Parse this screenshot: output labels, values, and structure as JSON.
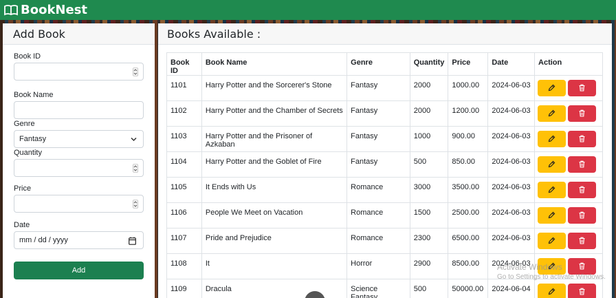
{
  "app": {
    "name": "BookNest"
  },
  "form": {
    "title": "Add Book",
    "fields": {
      "book_id": {
        "label": "Book ID",
        "value": ""
      },
      "book_name": {
        "label": "Book Name",
        "value": ""
      },
      "genre": {
        "label": "Genre",
        "value": "Fantasy"
      },
      "quantity": {
        "label": "Quantity",
        "value": ""
      },
      "price": {
        "label": "Price",
        "value": ""
      },
      "date": {
        "label": "Date",
        "value": "mm / dd / yyyy"
      }
    },
    "submit_label": "Add"
  },
  "books": {
    "title": "Books Available :",
    "columns": [
      "Book ID",
      "Book Name",
      "Genre",
      "Quantity",
      "Price",
      "Date",
      "Action"
    ],
    "rows": [
      {
        "id": "1101",
        "name": "Harry Potter and the Sorcerer's Stone",
        "genre": "Fantasy",
        "quantity": "2000",
        "price": "1000.00",
        "date": "2024-06-03"
      },
      {
        "id": "1102",
        "name": "Harry Potter and the Chamber of Secrets",
        "genre": "Fantasy",
        "quantity": "2000",
        "price": "1200.00",
        "date": "2024-06-03"
      },
      {
        "id": "1103",
        "name": "Harry Potter and the Prisoner of Azkaban",
        "genre": "Fantasy",
        "quantity": "1000",
        "price": "900.00",
        "date": "2024-06-03"
      },
      {
        "id": "1104",
        "name": "Harry Potter and the Goblet of Fire",
        "genre": "Fantasy",
        "quantity": "500",
        "price": "850.00",
        "date": "2024-06-03"
      },
      {
        "id": "1105",
        "name": "It Ends with Us",
        "genre": "Romance",
        "quantity": "3000",
        "price": "3500.00",
        "date": "2024-06-03"
      },
      {
        "id": "1106",
        "name": "People We Meet on Vacation",
        "genre": "Romance",
        "quantity": "1500",
        "price": "2500.00",
        "date": "2024-06-03"
      },
      {
        "id": "1107",
        "name": "Pride and Prejudice",
        "genre": "Romance",
        "quantity": "2300",
        "price": "6500.00",
        "date": "2024-06-03"
      },
      {
        "id": "1108",
        "name": "It",
        "genre": "Horror",
        "quantity": "2900",
        "price": "8500.00",
        "date": "2024-06-03"
      },
      {
        "id": "1109",
        "name": "Dracula",
        "genre": "Science Fantasy",
        "quantity": "500",
        "price": "50000.00",
        "date": "2024-06-04"
      }
    ]
  },
  "watermark": {
    "title": "Activate Windows",
    "subtitle": "Go to Settings to activate Windows."
  },
  "colors": {
    "navbar": "#1f8a4f",
    "add_button": "#1c8050",
    "edit_button": "#ffc107",
    "delete_button": "#dc3545"
  },
  "icons": {
    "brand": "open-book-icon",
    "edit": "pencil-icon",
    "delete": "trash-icon",
    "date": "calendar-icon",
    "select": "chevron-down-icon",
    "number": "spinner-icon"
  }
}
